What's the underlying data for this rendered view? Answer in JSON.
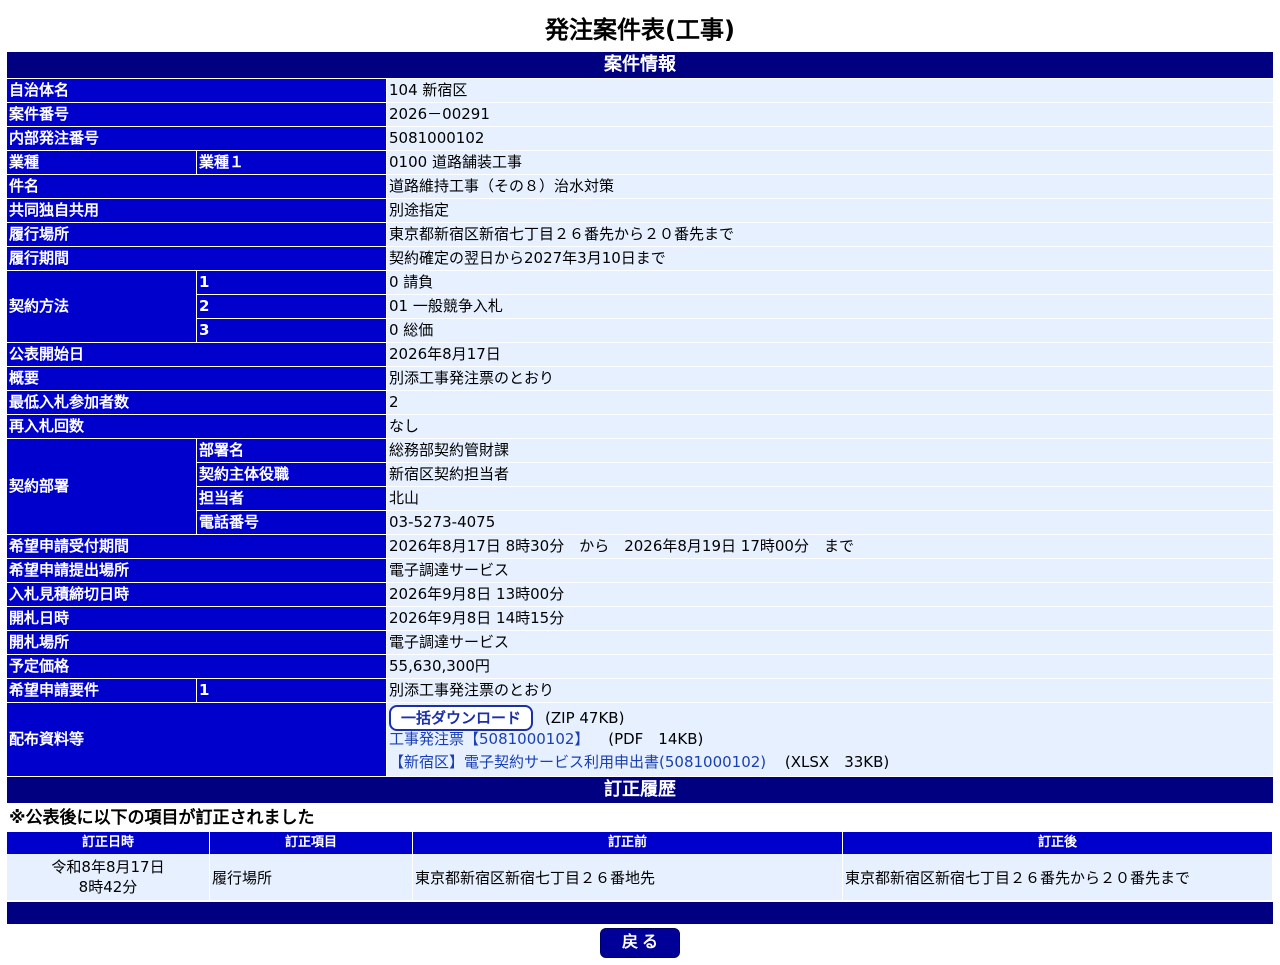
{
  "title": "発注案件表(工事)",
  "section_info": "案件情報",
  "rows": {
    "jichitai": {
      "label": "自治体名",
      "value": "104 新宿区"
    },
    "anken_no": {
      "label": "案件番号",
      "value": "2026－00291"
    },
    "naibu_no": {
      "label": "内部発注番号",
      "value": "5081000102"
    },
    "gyoshu": {
      "label": "業種",
      "sub": "業種１",
      "value": "0100 道路舗装工事"
    },
    "kenmei": {
      "label": "件名",
      "value": "道路維持工事（その８）治水対策"
    },
    "kyodo": {
      "label": "共同独自共用",
      "value": "別途指定"
    },
    "basho": {
      "label": "履行場所",
      "value": "東京都新宿区新宿七丁目２６番先から２０番先まで"
    },
    "kikan": {
      "label": "履行期間",
      "value": "契約確定の翌日から2027年3月10日まで"
    },
    "keiyaku_hoho": {
      "label": "契約方法",
      "items": [
        {
          "sub": "1",
          "value": "0 請負"
        },
        {
          "sub": "2",
          "value": "01 一般競争入札"
        },
        {
          "sub": "3",
          "value": "0 総価"
        }
      ]
    },
    "kohyo": {
      "label": "公表開始日",
      "value": "2026年8月17日"
    },
    "gaiyo": {
      "label": "概要",
      "value": "別添工事発注票のとおり"
    },
    "saitei": {
      "label": "最低入札参加者数",
      "value": "2"
    },
    "sainyusatsu": {
      "label": "再入札回数",
      "value": "なし"
    },
    "keiyaku_busho": {
      "label": "契約部署",
      "items": [
        {
          "sub": "部署名",
          "value": "総務部契約管財課"
        },
        {
          "sub": "契約主体役職",
          "value": "新宿区契約担当者"
        },
        {
          "sub": "担当者",
          "value": "北山"
        },
        {
          "sub": "電話番号",
          "value": "03-5273-4075"
        }
      ]
    },
    "kibo_kikan": {
      "label": "希望申請受付期間",
      "value": "2026年8月17日 8時30分　から　2026年8月19日 17時00分　まで"
    },
    "kibo_basho": {
      "label": "希望申請提出場所",
      "value": "電子調達サービス"
    },
    "mitsumori": {
      "label": "入札見積締切日時",
      "value": "2026年9月8日 13時00分"
    },
    "kaisatsu_nichiji": {
      "label": "開札日時",
      "value": "2026年9月8日 14時15分"
    },
    "kaisatsu_basho": {
      "label": "開札場所",
      "value": "電子調達サービス"
    },
    "yotei": {
      "label": "予定価格",
      "value": "55,630,300円"
    },
    "kibo_yoken": {
      "label": "希望申請要件",
      "sub": "1",
      "value": "別添工事発注票のとおり"
    },
    "haifu": {
      "label": "配布資料等",
      "download_label": "一括ダウンロード",
      "download_meta": "(ZIP 47KB)",
      "files": [
        {
          "name": "工事発注票【5081000102】",
          "meta": "(PDF　14KB)"
        },
        {
          "name": "【新宿区】電子契約サービス利用申出書(5081000102)",
          "meta": "(XLSX　33KB)"
        }
      ]
    }
  },
  "section_history": "訂正履歴",
  "history_note": "※公表後に以下の項目が訂正されました",
  "history": {
    "headers": [
      "訂正日時",
      "訂正項目",
      "訂正前",
      "訂正後"
    ],
    "rows": [
      {
        "date_line1": "令和8年8月17日",
        "date_line2": "8時42分",
        "item": "履行場所",
        "before": "東京都新宿区新宿七丁目２６番地先",
        "after": "東京都新宿区新宿七丁目２６番先から２０番先まで"
      }
    ]
  },
  "back_label": "戻る"
}
